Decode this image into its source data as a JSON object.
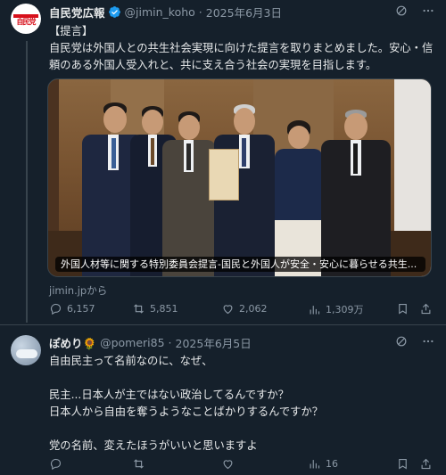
{
  "tweet1": {
    "display_name": "自民党広報",
    "handle": "@jimin_koho",
    "date": "2025年6月3日",
    "text": "【提言】\n自民党は外国人との共生社会実現に向けた提言を取りまとめました。安心・信頼のある外国人受入れと、共に支え合う社会の実現を目指します。",
    "avatar_text": "自民党",
    "media_caption": "外国人材等に関する特別委員会提言-国民と外国人が安全・安心に暮らせる共生...",
    "card_source": "jimin.jpから",
    "stats": {
      "replies": "6,157",
      "reposts": "5,851",
      "likes": "2,062",
      "views": "1,309万"
    }
  },
  "tweet2": {
    "display_name": "ぽめり🌻",
    "handle": "@pomeri85",
    "date": "2025年6月5日",
    "text": "自由民主って名前なのに、なぜ、\n\n民主...日本人が主ではない政治してるんですか？\n日本人から自由を奪うようなことばかりするんですか？\n\n党の名前、変えたほうがいいと思いますよ",
    "stats": {
      "views": "16"
    }
  },
  "colors": {
    "background": "#15202b",
    "text": "#e7e9ea",
    "muted": "#8b98a5",
    "verified": "#1d9bf0",
    "divider": "#38444d"
  },
  "icons": [
    "grok-icon",
    "more-icon",
    "reply-icon",
    "repost-icon",
    "like-icon",
    "views-icon",
    "bookmark-icon",
    "share-icon"
  ]
}
